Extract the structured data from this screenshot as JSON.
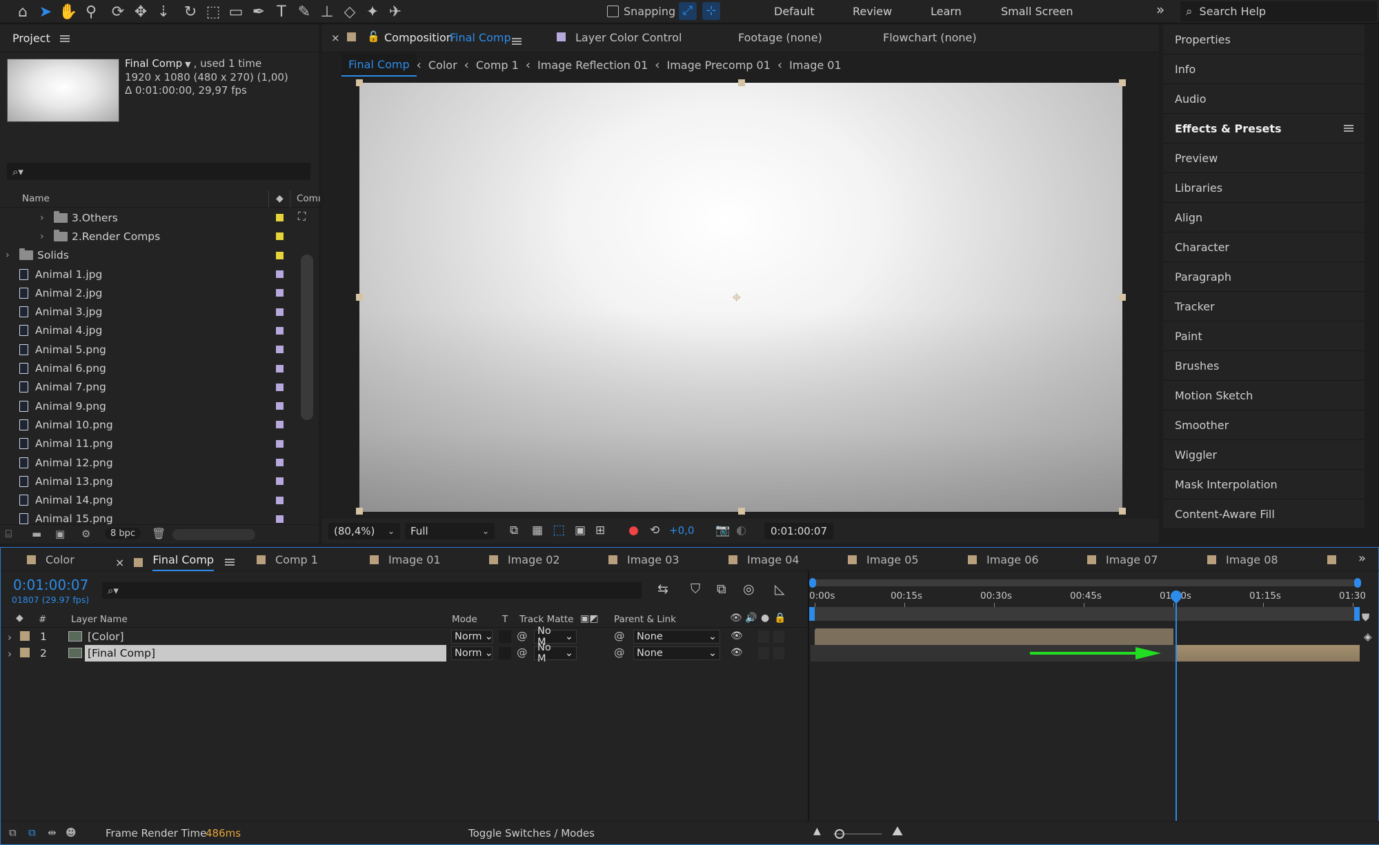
{
  "toolbar": {
    "tools": [
      "home-icon",
      "selection-icon",
      "hand-icon",
      "zoom-icon",
      "orbit-icon",
      "pan-icon",
      "dolly-icon",
      "rotate-icon",
      "region-icon",
      "rectangle-icon",
      "pen-icon",
      "text-icon",
      "brush-icon",
      "stamp-icon",
      "eraser-icon",
      "roto-icon",
      "puppet-icon"
    ],
    "snapping_label": "Snapping",
    "workspaces": [
      "Default",
      "Review",
      "Learn",
      "Small Screen"
    ],
    "search_placeholder": "Search Help"
  },
  "project": {
    "title": "Project",
    "comp_name": "Final Comp",
    "comp_used": ", used 1 time",
    "comp_size": "1920 x 1080  (480 x 270) (1,00)",
    "comp_duration": "Δ 0:01:00:00, 29,97 fps",
    "search_placeholder": "",
    "col_name": "Name",
    "col_comment": "Comı",
    "items": [
      {
        "label": "3.Others",
        "type": "folder",
        "indent": 1,
        "color": "#e5d43a"
      },
      {
        "label": "2.Render Comps",
        "type": "folder",
        "indent": 1,
        "color": "#e5d43a"
      },
      {
        "label": "Solids",
        "type": "folder",
        "indent": 0,
        "color": "#e5d43a"
      },
      {
        "label": "Animal 1.jpg",
        "type": "file",
        "color": "#b7a9dd"
      },
      {
        "label": "Animal 2.jpg",
        "type": "file",
        "color": "#b7a9dd"
      },
      {
        "label": "Animal 3.jpg",
        "type": "file",
        "color": "#b7a9dd"
      },
      {
        "label": "Animal 4.jpg",
        "type": "file",
        "color": "#b7a9dd"
      },
      {
        "label": "Animal 5.png",
        "type": "file",
        "color": "#b7a9dd"
      },
      {
        "label": "Animal 6.png",
        "type": "file",
        "color": "#b7a9dd"
      },
      {
        "label": "Animal 7.png",
        "type": "file",
        "color": "#b7a9dd"
      },
      {
        "label": "Animal 9.png",
        "type": "file",
        "color": "#b7a9dd"
      },
      {
        "label": "Animal 10.png",
        "type": "file",
        "color": "#b7a9dd"
      },
      {
        "label": "Animal 11.png",
        "type": "file",
        "color": "#b7a9dd"
      },
      {
        "label": "Animal 12.png",
        "type": "file",
        "color": "#b7a9dd"
      },
      {
        "label": "Animal 13.png",
        "type": "file",
        "color": "#b7a9dd"
      },
      {
        "label": "Animal 14.png",
        "type": "file",
        "color": "#b7a9dd"
      },
      {
        "label": "Animal 15.png",
        "type": "file",
        "color": "#b7a9dd"
      }
    ],
    "bpc": "8 bpc"
  },
  "composition": {
    "tab_prefix": "Composition",
    "tab_name": "Final Comp",
    "other_tabs": [
      "Layer Color Control",
      "Footage (none)",
      "Flowchart (none)"
    ],
    "breadcrumbs": [
      "Final Comp",
      "Color",
      "Comp 1",
      "Image Reflection 01",
      "Image Precomp 01",
      "Image 01"
    ],
    "zoom": "(80,4%)",
    "resolution": "Full",
    "exposure": "+0,0",
    "timecode": "0:01:00:07"
  },
  "right_panels": [
    "Properties",
    "Info",
    "Audio",
    "Effects & Presets",
    "Preview",
    "Libraries",
    "Align",
    "Character",
    "Paragraph",
    "Tracker",
    "Paint",
    "Brushes",
    "Motion Sketch",
    "Smoother",
    "Wiggler",
    "Mask Interpolation",
    "Content-Aware Fill"
  ],
  "timeline": {
    "tabs": [
      "Color",
      "Final Comp",
      "Comp 1",
      "Image 01",
      "Image 02",
      "Image 03",
      "Image 04",
      "Image 05",
      "Image 06",
      "Image 07",
      "Image 08"
    ],
    "current_time": "0:01:00:07",
    "frame_info": "01807 (29.97 fps)",
    "columns": {
      "layer_name": "Layer Name",
      "mode": "Mode",
      "t": "T",
      "track_matte": "Track Matte",
      "parent": "Parent & Link"
    },
    "layers": [
      {
        "num": "1",
        "name": "[Color]",
        "mode": "Norm",
        "matte": "No M",
        "parent": "None"
      },
      {
        "num": "2",
        "name": "[Final Comp]",
        "mode": "Norm",
        "matte": "No M",
        "parent": "None"
      }
    ],
    "ruler": [
      "0:00s",
      "00:15s",
      "00:30s",
      "00:45s",
      "01:00s",
      "01:15s",
      "01:30"
    ],
    "render_time_label": "Frame Render Time",
    "render_time_value": "486ms",
    "toggle_label": "Toggle Switches / Modes"
  }
}
